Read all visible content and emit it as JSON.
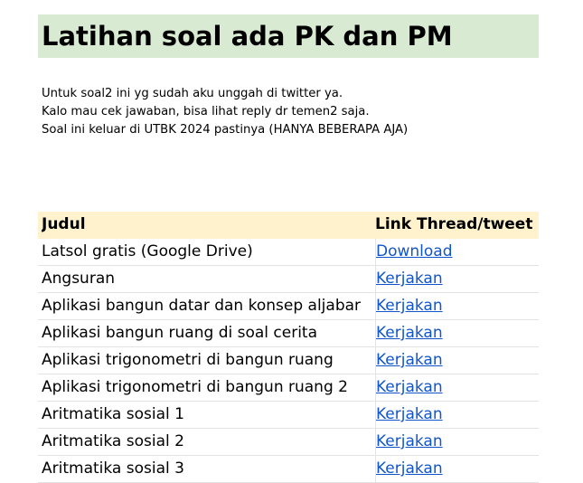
{
  "header": {
    "title": "Latihan soal ada PK dan PM"
  },
  "description": [
    "Untuk soal2 ini yg sudah aku unggah di twitter ya.",
    "Kalo mau cek jawaban, bisa lihat reply dr temen2 saja.",
    "Soal ini keluar di UTBK 2024 pastinya (HANYA BEBERAPA AJA)"
  ],
  "table": {
    "columns": [
      "Judul",
      "Link Thread/tweet"
    ],
    "rows": [
      {
        "title": "Latsol gratis (Google Drive)",
        "link": "Download "
      },
      {
        "title": "Angsuran",
        "link": "Kerjakan"
      },
      {
        "title": "Aplikasi bangun datar dan konsep aljabar",
        "link": "Kerjakan"
      },
      {
        "title": "Aplikasi bangun ruang di soal cerita",
        "link": "Kerjakan"
      },
      {
        "title": "Aplikasi trigonometri di bangun ruang",
        "link": "Kerjakan"
      },
      {
        "title": "Aplikasi trigonometri di bangun ruang 2",
        "link": "Kerjakan"
      },
      {
        "title": "Aritmatika sosial 1",
        "link": "Kerjakan"
      },
      {
        "title": "Aritmatika sosial 2",
        "link": "Kerjakan"
      },
      {
        "title": "Aritmatika sosial 3",
        "link": "Kerjakan"
      }
    ]
  },
  "colors": {
    "title_band": "#d9ead3",
    "header_band": "#fff2cc",
    "link": "#1155cc"
  }
}
